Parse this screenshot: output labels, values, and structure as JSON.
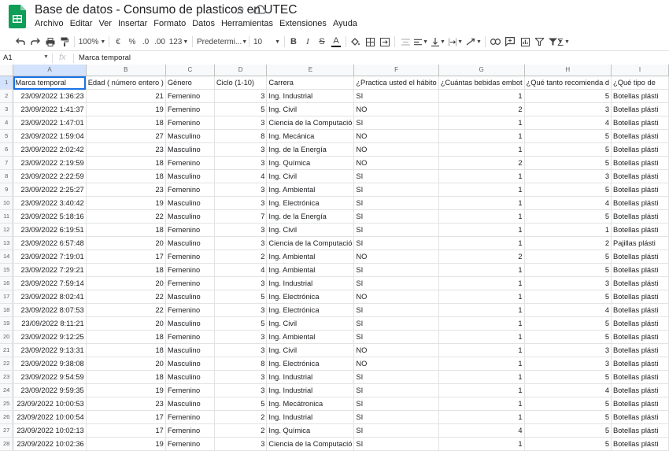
{
  "doc": {
    "title": "Base de datos - Consumo de plasticos en UTEC"
  },
  "menu": [
    "Archivo",
    "Editar",
    "Ver",
    "Insertar",
    "Formato",
    "Datos",
    "Herramientas",
    "Extensiones",
    "Ayuda"
  ],
  "toolbar": {
    "zoom": "100%",
    "currency": "€",
    "percent": "%",
    "dec_less": ".0",
    "dec_more": ".00",
    "format_more": "123",
    "font": "Predetermi...",
    "size": "10",
    "bold": "B",
    "italic": "I",
    "strike": "S",
    "text_color": "A"
  },
  "formula_bar": {
    "cell": "A1",
    "fx": "fx",
    "value": "Marca temporal"
  },
  "columns": [
    "A",
    "B",
    "C",
    "D",
    "E",
    "F",
    "G",
    "H",
    "I"
  ],
  "header_row": [
    "Marca temporal",
    "Edad ( número entero )",
    "Género",
    "Ciclo (1-10)",
    "Carrera",
    "¿Practica usted el hábito",
    "¿Cuántas bebidas embot",
    "¿Qué tanto recomienda d",
    "¿Qué tipo de"
  ],
  "rows": [
    [
      "23/09/2022 1:36:23",
      "21",
      "Femenino",
      "3",
      "Ing. Industrial",
      "SI",
      "1",
      "5",
      "Botellas plásti"
    ],
    [
      "23/09/2022 1:41:37",
      "19",
      "Femenino",
      "5",
      "Ing. Civil",
      "NO",
      "2",
      "3",
      "Botellas plásti"
    ],
    [
      "23/09/2022 1:47:01",
      "18",
      "Femenino",
      "3",
      "Ciencia de la Computació",
      "SI",
      "1",
      "4",
      "Botellas plásti"
    ],
    [
      "23/09/2022 1:59:04",
      "27",
      "Masculino",
      "8",
      "Ing. Mecánica",
      "NO",
      "1",
      "5",
      "Botellas plásti"
    ],
    [
      "23/09/2022 2:02:42",
      "23",
      "Masculino",
      "3",
      "Ing. de la Energía",
      "NO",
      "1",
      "5",
      "Botellas plásti"
    ],
    [
      "23/09/2022 2:19:59",
      "18",
      "Femenino",
      "3",
      "Ing. Química",
      "NO",
      "2",
      "5",
      "Botellas plásti"
    ],
    [
      "23/09/2022 2:22:59",
      "18",
      "Masculino",
      "4",
      "Ing. Civil",
      "SI",
      "1",
      "3",
      "Botellas plásti"
    ],
    [
      "23/09/2022 2:25:27",
      "23",
      "Femenino",
      "3",
      "Ing. Ambiental",
      "SI",
      "1",
      "5",
      "Botellas plásti"
    ],
    [
      "23/09/2022 3:40:42",
      "19",
      "Masculino",
      "3",
      "Ing. Electrónica",
      "SI",
      "1",
      "4",
      "Botellas plásti"
    ],
    [
      "23/09/2022 5:18:16",
      "22",
      "Masculino",
      "7",
      "Ing. de la Energía",
      "SI",
      "1",
      "5",
      "Botellas plásti"
    ],
    [
      "23/09/2022 6:19:51",
      "18",
      "Femenino",
      "3",
      "Ing. Civil",
      "SI",
      "1",
      "1",
      "Botellas plásti"
    ],
    [
      "23/09/2022 6:57:48",
      "20",
      "Masculino",
      "3",
      "Ciencia de la Computació",
      "SI",
      "1",
      "2",
      "Pajillas plásti"
    ],
    [
      "23/09/2022 7:19:01",
      "17",
      "Femenino",
      "2",
      "Ing. Ambiental",
      "NO",
      "2",
      "5",
      "Botellas plásti"
    ],
    [
      "23/09/2022 7:29:21",
      "18",
      "Femenino",
      "4",
      "Ing. Ambiental",
      "SI",
      "1",
      "5",
      "Botellas plásti"
    ],
    [
      "23/09/2022 7:59:14",
      "20",
      "Femenino",
      "3",
      "Ing. Industrial",
      "SI",
      "1",
      "3",
      "Botellas plásti"
    ],
    [
      "23/09/2022 8:02:41",
      "22",
      "Masculino",
      "5",
      "Ing. Electrónica",
      "NO",
      "1",
      "5",
      "Botellas plásti"
    ],
    [
      "23/09/2022 8:07:53",
      "22",
      "Femenino",
      "3",
      "Ing. Electrónica",
      "SI",
      "1",
      "4",
      "Botellas plásti"
    ],
    [
      "23/09/2022 8:11:21",
      "20",
      "Masculino",
      "5",
      "Ing. Civil",
      "SI",
      "1",
      "5",
      "Botellas plásti"
    ],
    [
      "23/09/2022 9:12:25",
      "18",
      "Femenino",
      "3",
      "Ing. Ambiental",
      "SI",
      "1",
      "5",
      "Botellas plásti"
    ],
    [
      "23/09/2022 9:13:31",
      "18",
      "Masculino",
      "3",
      "Ing. Civil",
      "NO",
      "1",
      "3",
      "Botellas plásti"
    ],
    [
      "23/09/2022 9:38:08",
      "20",
      "Masculino",
      "8",
      "Ing. Electrónica",
      "NO",
      "1",
      "3",
      "Botellas plásti"
    ],
    [
      "23/09/2022 9:54:59",
      "18",
      "Masculino",
      "3",
      "Ing. Industrial",
      "SI",
      "1",
      "5",
      "Botellas plásti"
    ],
    [
      "23/09/2022 9:59:35",
      "19",
      "Femenino",
      "3",
      "Ing. Industrial",
      "SI",
      "1",
      "4",
      "Botellas plásti"
    ],
    [
      "23/09/2022 10:00:53",
      "23",
      "Masculino",
      "5",
      "Ing. Mecátronica",
      "SI",
      "1",
      "5",
      "Botellas plásti"
    ],
    [
      "23/09/2022 10:00:54",
      "17",
      "Femenino",
      "2",
      "Ing. Industrial",
      "SI",
      "1",
      "5",
      "Botellas plásti"
    ],
    [
      "23/09/2022 10:02:13",
      "17",
      "Femenino",
      "2",
      "Ing. Química",
      "SI",
      "4",
      "5",
      "Botellas plásti"
    ],
    [
      "23/09/2022 10:02:36",
      "19",
      "Femenino",
      "3",
      "Ciencia de la Computació",
      "SI",
      "1",
      "5",
      "Botellas plásti"
    ]
  ]
}
